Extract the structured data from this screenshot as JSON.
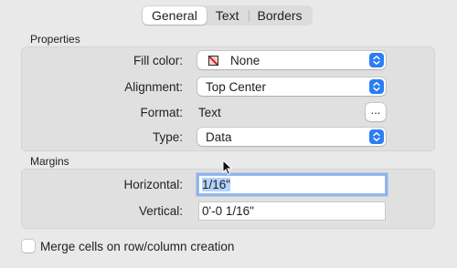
{
  "tabs": [
    {
      "label": "General",
      "active": true
    },
    {
      "label": "Text",
      "active": false
    },
    {
      "label": "Borders",
      "active": false
    }
  ],
  "properties": {
    "title": "Properties",
    "fill_color": {
      "label": "Fill color:",
      "value": "None",
      "swatch_icon": "no-fill-swatch-icon"
    },
    "alignment": {
      "label": "Alignment:",
      "value": "Top Center"
    },
    "format": {
      "label": "Format:",
      "value": "Text",
      "button_label": "..."
    },
    "type": {
      "label": "Type:",
      "value": "Data"
    }
  },
  "margins": {
    "title": "Margins",
    "horizontal": {
      "label": "Horizontal:",
      "value": "1/16\""
    },
    "vertical": {
      "label": "Vertical:",
      "value": "0'-0 1/16\""
    }
  },
  "merge_checkbox": {
    "label": "Merge cells on row/column creation",
    "checked": false
  },
  "colors": {
    "accent": "#2a7ef5",
    "focus_ring": "#8fb3ea",
    "selection": "#b3d3fd"
  }
}
